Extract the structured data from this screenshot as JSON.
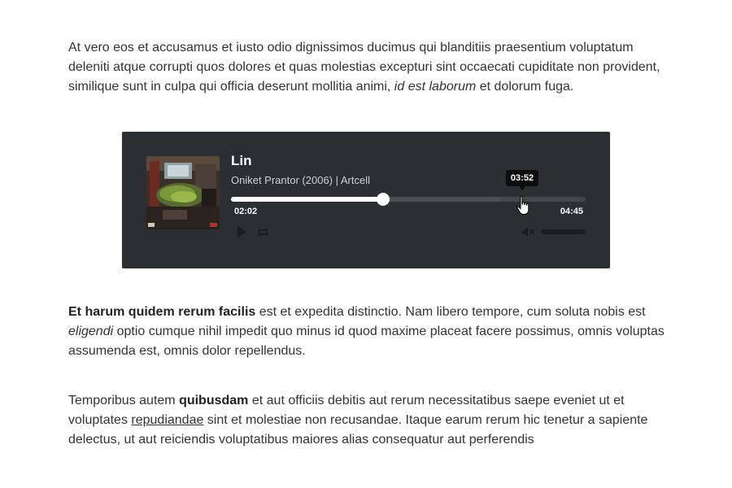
{
  "paragraph1": {
    "segment1": "At vero eos et accusamus et iusto odio dignissimos ducimus qui blanditiis praesentium voluptatum deleniti atque corrupti quos dolores et quas molestias excepturi sint occaecati cupiditate non provident, similique sunt in culpa qui officia deserunt mollitia animi, ",
    "italic": "id est laborum",
    "segment2": " et dolorum fuga."
  },
  "player": {
    "title": "Lin",
    "meta": "Oniket Prantor (2006) | Artcell",
    "current_time": "02:02",
    "duration": "04:45",
    "hover_time": "03:52",
    "progress": 0.428,
    "buffered": 0.76,
    "hover_position": 0.816,
    "volume": 0.0,
    "icons": {
      "cover": "album-cover-image",
      "play": "play-icon",
      "repeat": "repeat-icon",
      "mute": "volume-mute-icon",
      "cursor": "hand-pointer-icon"
    }
  },
  "paragraph2": {
    "bold": "Et harum quidem rerum facilis",
    "segment1": " est et expedita distinctio. Nam libero tempore, cum soluta nobis est ",
    "italic": "eligendi",
    "segment2": " optio cumque nihil impedit quo minus id quod maxime placeat facere possimus, omnis voluptas assumenda est, omnis dolor repellendus."
  },
  "paragraph3": {
    "segment1": "Temporibus autem ",
    "bold": "quibusdam",
    "segment2": " et aut officiis debitis aut rerum necessitatibus saepe eveniet ut et voluptates ",
    "underline": "repudiandae",
    "segment3": " sint et molestiae non recusandae. Itaque earum rerum hic tenetur a sapiente delectus, ut aut reiciendis voluptatibus maiores alias consequatur aut perferendis"
  }
}
